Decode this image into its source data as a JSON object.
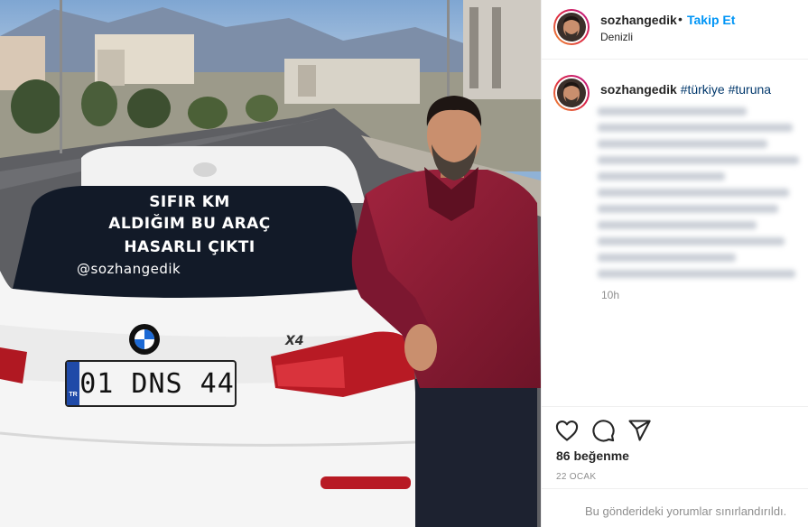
{
  "post": {
    "username": "sozhangedik",
    "follow_label": "Takip Et",
    "separator": "•",
    "location": "Denizli",
    "caption_hashtags": "#türkiye #turuna",
    "time_ago": "10h",
    "likes": "86 beğenme",
    "date": "22 OCAK",
    "comments_notice": "Bu gönderideki yorumlar sınırlandırıldı."
  },
  "photo": {
    "rear_window_lines": [
      "SIFIR KM",
      "ALDIĞIM BU ARAÇ",
      "HASARLI ÇIKTI",
      "@sozhangedik"
    ],
    "plate_country": "TR",
    "plate_number": "01 DNS 44",
    "car_model": "X4"
  },
  "icons": {
    "like": "heart-icon",
    "comment": "comment-bubble-icon",
    "share": "paper-plane-icon"
  },
  "colors": {
    "follow_blue": "#0095f6",
    "hashtag_blue": "#00376b",
    "jacket": "#8a1b33",
    "story_ring": "#dc2743"
  }
}
